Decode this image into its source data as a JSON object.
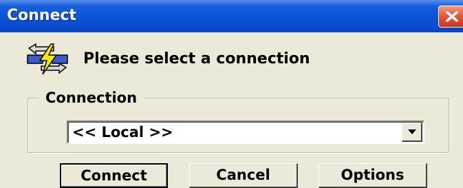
{
  "window": {
    "title": "Connect",
    "close_icon": "close-icon"
  },
  "header": {
    "icon": "connection-bolt-icon",
    "prompt": "Please select a connection"
  },
  "connection_group": {
    "legend": "Connection",
    "select": {
      "value": "<< Local >>",
      "dropdown_icon": "chevron-down-icon"
    }
  },
  "buttons": {
    "connect": "Connect",
    "cancel": "Cancel",
    "options": "Options"
  },
  "colors": {
    "titlebar": "#0a52d8",
    "dialog_bg": "#ece9d8",
    "close_button": "#e65b3a"
  }
}
